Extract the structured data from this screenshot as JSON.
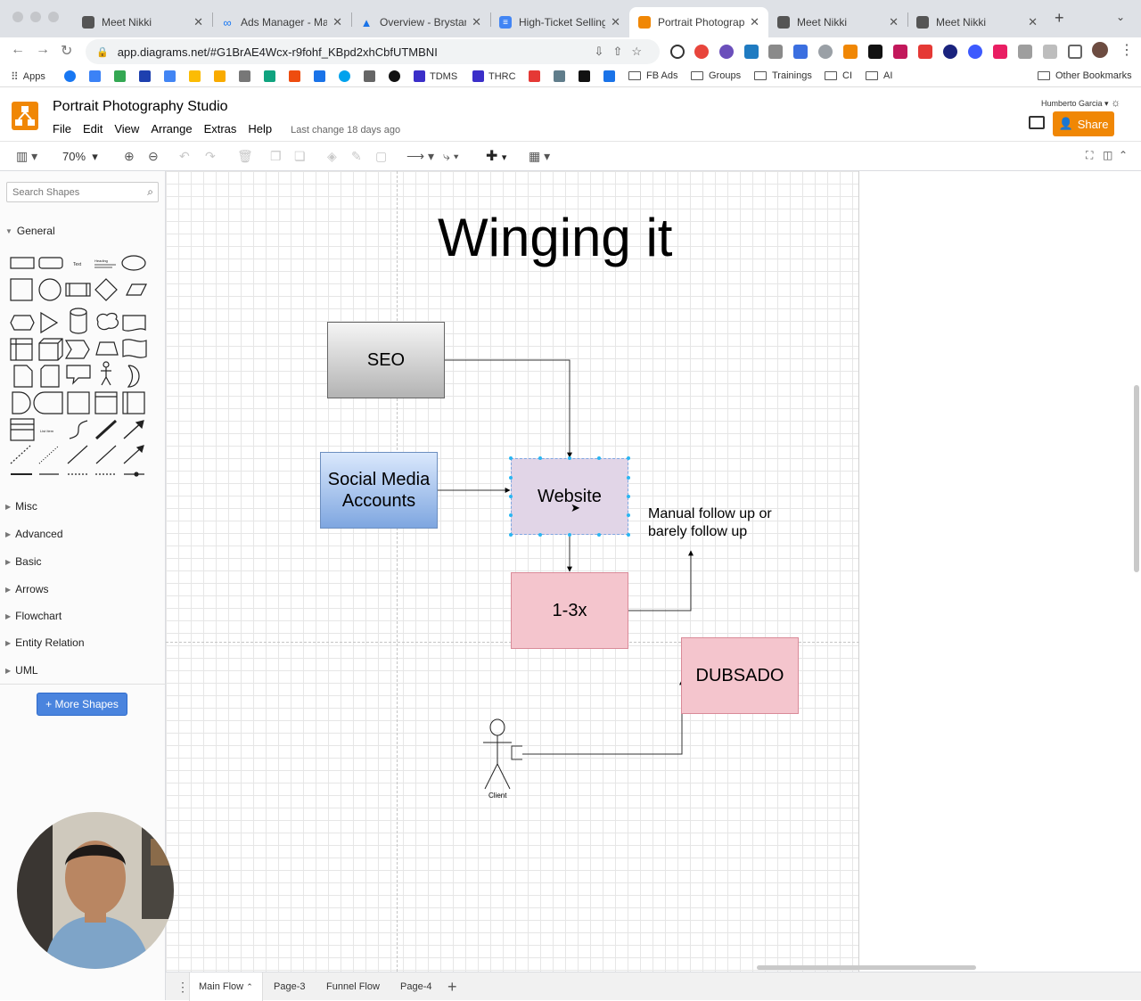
{
  "browser": {
    "tabs": [
      {
        "title": "Meet Nikki",
        "icon": "doc-icon",
        "active": false
      },
      {
        "title": "Ads Manager - Man",
        "icon": "meta-icon",
        "active": false
      },
      {
        "title": "Overview - Brystan",
        "icon": "google-ads-icon",
        "active": false
      },
      {
        "title": "High-Ticket Selling",
        "icon": "google-docs-icon",
        "active": false
      },
      {
        "title": "Portrait Photograph",
        "icon": "drawio-icon",
        "active": true
      },
      {
        "title": "Meet Nikki",
        "icon": "doc-icon",
        "active": false
      },
      {
        "title": "Meet Nikki",
        "icon": "doc-icon",
        "active": false
      }
    ],
    "url": "app.diagrams.net/#G1BrAE4Wcx-r9fohf_KBpd2xhCbfUTMBNI",
    "bookmarks": [
      "Apps",
      "TDMS",
      "THRC",
      "FB Ads",
      "Groups",
      "Trainings",
      "CI",
      "AI",
      "Other Bookmarks"
    ]
  },
  "app": {
    "title": "Portrait Photography Studio",
    "menu": [
      "File",
      "Edit",
      "View",
      "Arrange",
      "Extras",
      "Help"
    ],
    "last_change": "Last change 18 days ago",
    "user": "Humberto Garcia",
    "share_label": "Share",
    "zoom": "70%"
  },
  "sidebar": {
    "search_placeholder": "Search Shapes",
    "general_label": "General",
    "sections": [
      "Misc",
      "Advanced",
      "Basic",
      "Arrows",
      "Flowchart",
      "Entity Relation",
      "UML"
    ],
    "more_shapes": "+ More Shapes",
    "shape_text_label": "Text",
    "shape_heading_label": "Heading",
    "shape_list_label": "List Item"
  },
  "diagram": {
    "title": "Winging it",
    "nodes": {
      "seo": "SEO",
      "social_1": "Social Media",
      "social_2": "Accounts",
      "website": "Website",
      "times": "1-3x",
      "dubsado": "DUBSADO"
    },
    "annotation_1": "Manual follow up or",
    "annotation_2": "barely follow up",
    "client_label": "Client",
    "colors": {
      "seo": "#c7c7c7",
      "social": "#7ea6e0",
      "website": "#e1d5e7",
      "times": "#f4c5cd",
      "dubsado": "#f4c5cd"
    }
  },
  "pages": [
    "Main Flow",
    "Page-3",
    "Funnel Flow",
    "Page-4"
  ]
}
